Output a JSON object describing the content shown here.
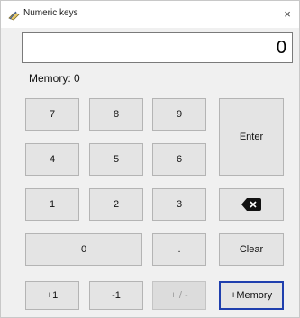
{
  "window": {
    "title": "Numeric keys",
    "close_glyph": "×",
    "app_icon": "pen-tablet-icon"
  },
  "display": {
    "value": "0"
  },
  "memory": {
    "label": "Memory: 0"
  },
  "keys": {
    "seven": "7",
    "eight": "8",
    "nine": "9",
    "enter": "Enter",
    "four": "4",
    "five": "5",
    "six": "6",
    "one": "1",
    "two": "2",
    "three": "3",
    "backspace_icon": "backspace-icon",
    "zero": "0",
    "dot": ".",
    "clear": "Clear",
    "plus_one": "+1",
    "minus_one": "-1",
    "sign": "+ / -",
    "memory": "+Memory"
  },
  "colors": {
    "key_background": "#e4e4e4",
    "focus_border": "#1f3fae",
    "disabled_text": "#9a9a9a"
  }
}
